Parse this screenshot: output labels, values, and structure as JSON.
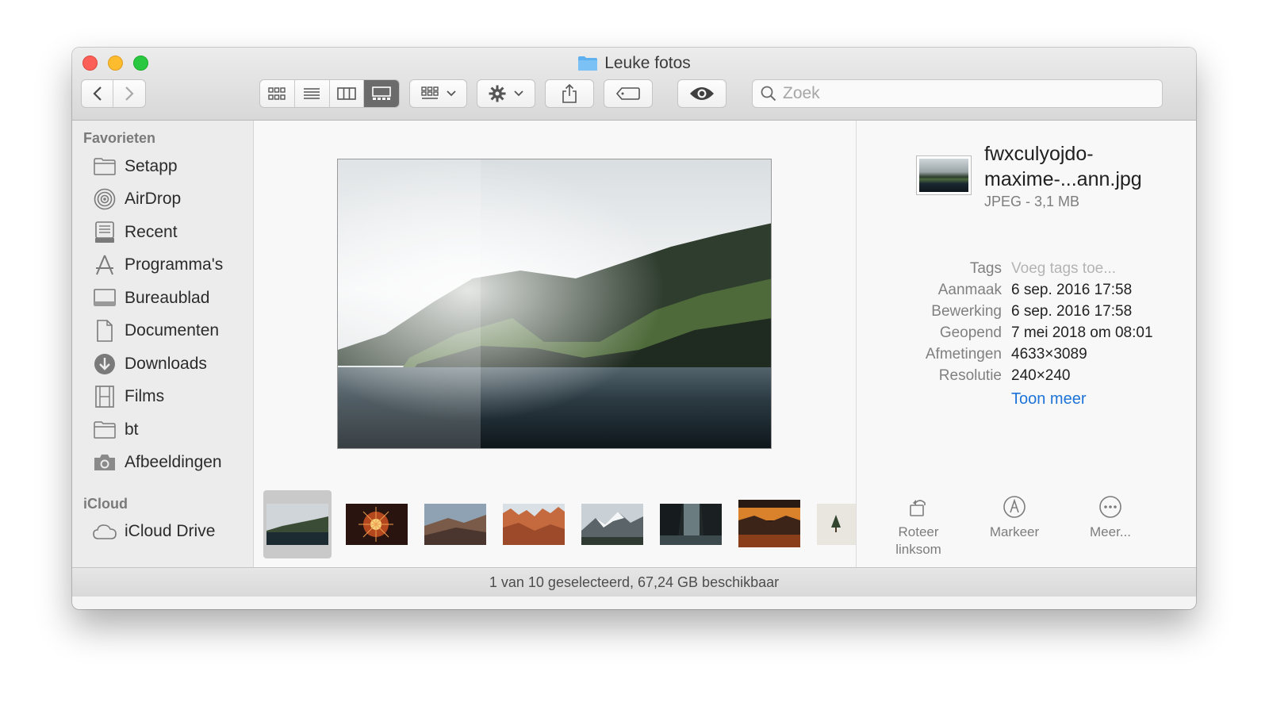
{
  "window": {
    "title": "Leuke fotos"
  },
  "toolbar": {
    "nav": [
      "back-icon",
      "forward-icon"
    ],
    "view_modes": [
      "icon-view",
      "list-view",
      "column-view",
      "gallery-view"
    ],
    "active_view": "gallery-view"
  },
  "search": {
    "placeholder": "Zoek",
    "value": ""
  },
  "sidebar": {
    "favorites_heading": "Favorieten",
    "favorites": [
      {
        "label": "Setapp",
        "icon": "folder-icon"
      },
      {
        "label": "AirDrop",
        "icon": "airdrop-icon"
      },
      {
        "label": "Recent",
        "icon": "recent-icon"
      },
      {
        "label": "Programma's",
        "icon": "applications-icon"
      },
      {
        "label": "Bureaublad",
        "icon": "desktop-icon"
      },
      {
        "label": "Documenten",
        "icon": "documents-icon"
      },
      {
        "label": "Downloads",
        "icon": "downloads-icon"
      },
      {
        "label": "Films",
        "icon": "movies-icon"
      },
      {
        "label": "bt",
        "icon": "folder-icon"
      },
      {
        "label": "Afbeeldingen",
        "icon": "camera-icon"
      }
    ],
    "icloud_heading": "iCloud",
    "icloud": [
      {
        "label": "iCloud Drive",
        "icon": "cloud-icon"
      }
    ]
  },
  "info": {
    "file_name": "fwxculyojdo-maxime-...ann.jpg",
    "kind": "JPEG - 3,1 MB",
    "rows": [
      {
        "key": "Tags",
        "value": "Voeg tags toe...",
        "placeholder": true
      },
      {
        "key": "Aanmaak",
        "value": "6 sep. 2016 17:58"
      },
      {
        "key": "Bewerking",
        "value": "6 sep. 2016 17:58"
      },
      {
        "key": "Geopend",
        "value": "7 mei 2018 om 08:01"
      },
      {
        "key": "Afmetingen",
        "value": "4633×3089"
      },
      {
        "key": "Resolutie",
        "value": "240×240"
      }
    ],
    "show_more": "Toon meer",
    "actions": [
      {
        "label_line1": "Roteer",
        "label_line2": "linksom",
        "icon": "rotate-left-icon"
      },
      {
        "label_line1": "Markeer",
        "label_line2": "",
        "icon": "markup-icon"
      },
      {
        "label_line1": "Meer...",
        "label_line2": "",
        "icon": "more-icon"
      }
    ]
  },
  "status": {
    "text": "1 van 10 geselecteerd, 67,24 GB beschikbaar"
  }
}
